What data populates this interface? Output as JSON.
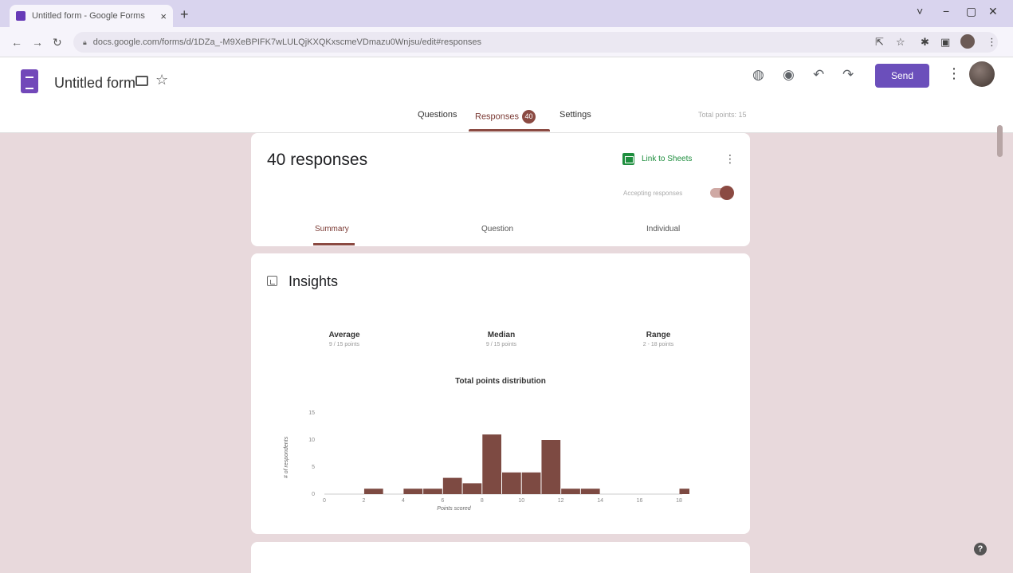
{
  "browser": {
    "tab_title": "Untitled form - Google Forms",
    "tab_close": "×",
    "new_tab": "+",
    "url": "docs.google.com/forms/d/1DZa_-M9XeBPIFK7wLULQjKXQKxscmeVDmazu0Wnjsu/edit#responses",
    "window_controls": {
      "minimize": "−",
      "restore": "▢",
      "close": "✕",
      "menu": "˅"
    }
  },
  "header": {
    "form_title": "Untitled form",
    "send_label": "Send"
  },
  "main_tabs": {
    "questions": "Questions",
    "responses": "Responses",
    "responses_badge": "40",
    "settings": "Settings",
    "total_points": "Total points: 15"
  },
  "summary_card": {
    "responses_title": "40 responses",
    "link_to_sheets": "Link to Sheets",
    "accepting_responses": "Accepting responses",
    "accepting_on": true,
    "subtabs": {
      "summary": "Summary",
      "question": "Question",
      "individual": "Individual"
    }
  },
  "insights": {
    "title": "Insights",
    "stats": [
      {
        "label": "Average",
        "value": "9 / 15 points"
      },
      {
        "label": "Median",
        "value": "9 / 15 points"
      },
      {
        "label": "Range",
        "value": "2 - 18 points"
      }
    ]
  },
  "chart_data": {
    "type": "bar",
    "title": "Total points distribution",
    "xlabel": "Points scored",
    "ylabel": "# of respondents",
    "x": [
      0,
      1,
      2,
      3,
      4,
      5,
      6,
      7,
      8,
      9,
      10,
      11,
      12,
      13,
      14,
      15,
      16,
      17,
      18
    ],
    "values": [
      0,
      0,
      1,
      0,
      1,
      1,
      3,
      2,
      11,
      4,
      4,
      10,
      1,
      1,
      0,
      0,
      0,
      0,
      1
    ],
    "xlim": [
      0,
      18
    ],
    "ylim": [
      0,
      15
    ],
    "x_ticks": [
      0,
      2,
      4,
      6,
      8,
      10,
      12,
      14,
      16,
      18
    ],
    "y_ticks": [
      0,
      5,
      10,
      15
    ],
    "grid": false,
    "bar_color": "#7d4a42"
  },
  "colors": {
    "accent": "#8b4a42",
    "forms_purple": "#6b4fbb",
    "background": "#e8d9dc",
    "sheets_green": "#1e8e3e"
  }
}
